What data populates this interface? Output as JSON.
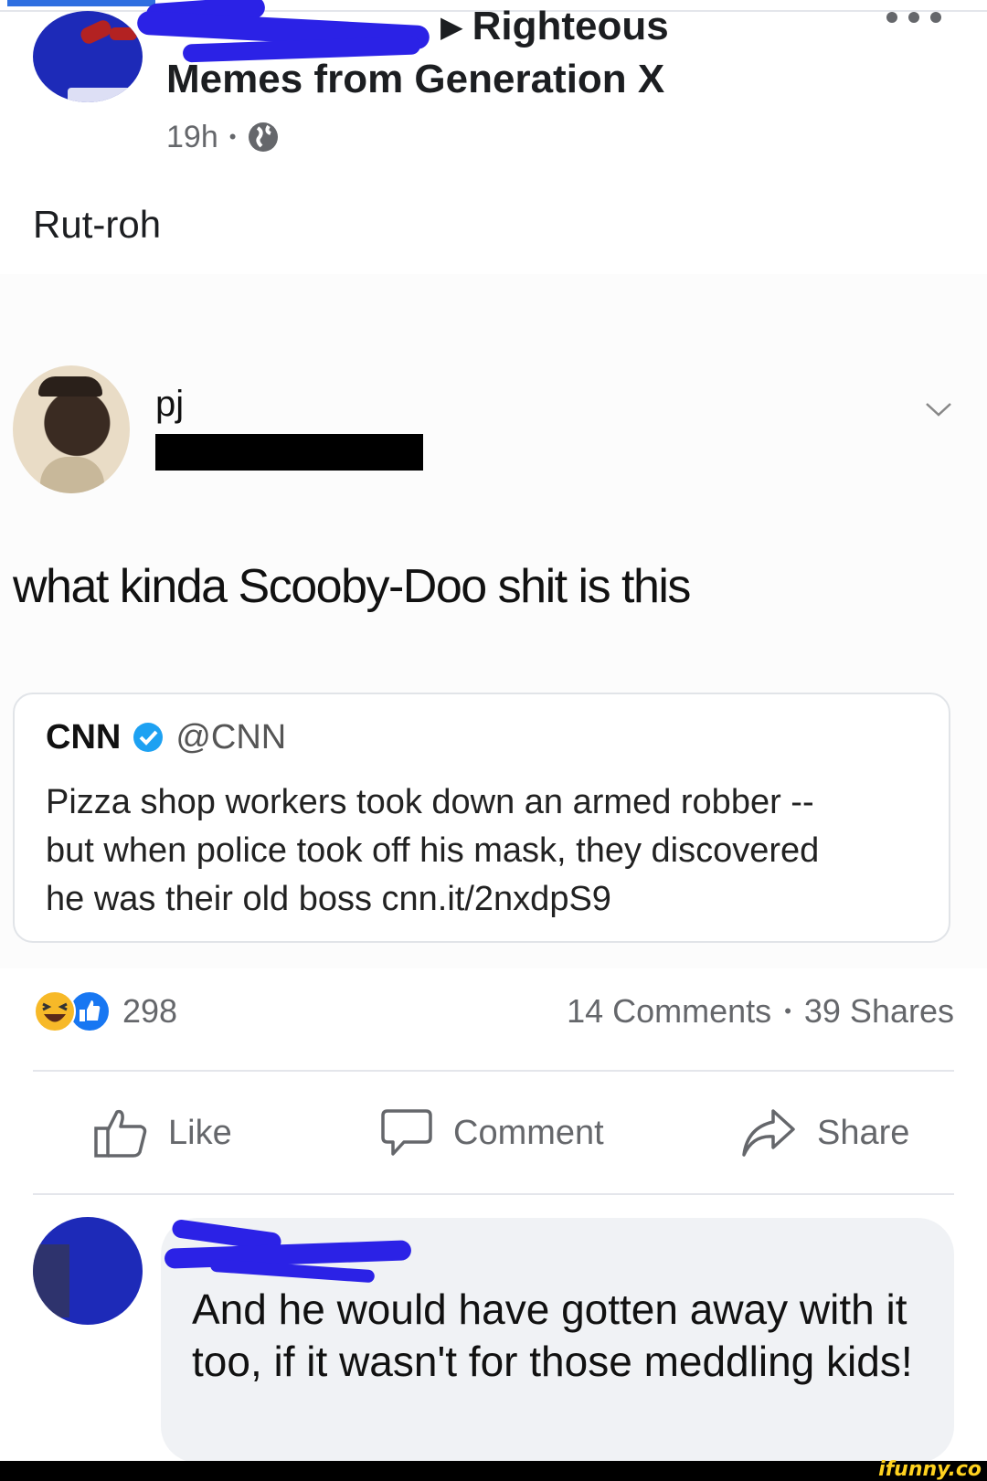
{
  "post": {
    "group_arrow": "▶",
    "group_line1": "Righteous",
    "group_line2": "Memes from Generation X",
    "time": "19h",
    "dot": "•",
    "privacy_icon": "globe-icon",
    "more_icon": "more-horizontal-icon",
    "text": "Rut-roh"
  },
  "shared_image": {
    "author_name": "pj",
    "tweet_text": "what kinda Scooby-Doo shit is this",
    "quoted": {
      "name": "CNN",
      "verified_icon": "verified-badge-icon",
      "handle": "@CNN",
      "text_lines": [
        "Pizza shop workers took down an armed robber --",
        "but when police took off his mask, they discovered",
        "he was their old boss cnn.it/2nxdpS9"
      ]
    }
  },
  "reactions": {
    "icons": [
      "haha-icon",
      "like-icon"
    ],
    "count": "298",
    "comments": "14 Comments",
    "separator": "•",
    "shares": "39 Shares"
  },
  "actions": {
    "like": "Like",
    "comment": "Comment",
    "share": "Share"
  },
  "comment": {
    "text": "And he would have gotten away with it too, if it wasn't for those meddling kids!"
  },
  "watermark": "ifunny.co",
  "colors": {
    "accent": "#2f6fe0",
    "scribble": "#2b22e6",
    "meta_gray": "#65676b",
    "bubble": "#f0f2f5",
    "verified": "#1da1f2",
    "like_blue": "#1877f2",
    "haha_yellow": "#f7b928",
    "watermark": "#ffd21f"
  }
}
